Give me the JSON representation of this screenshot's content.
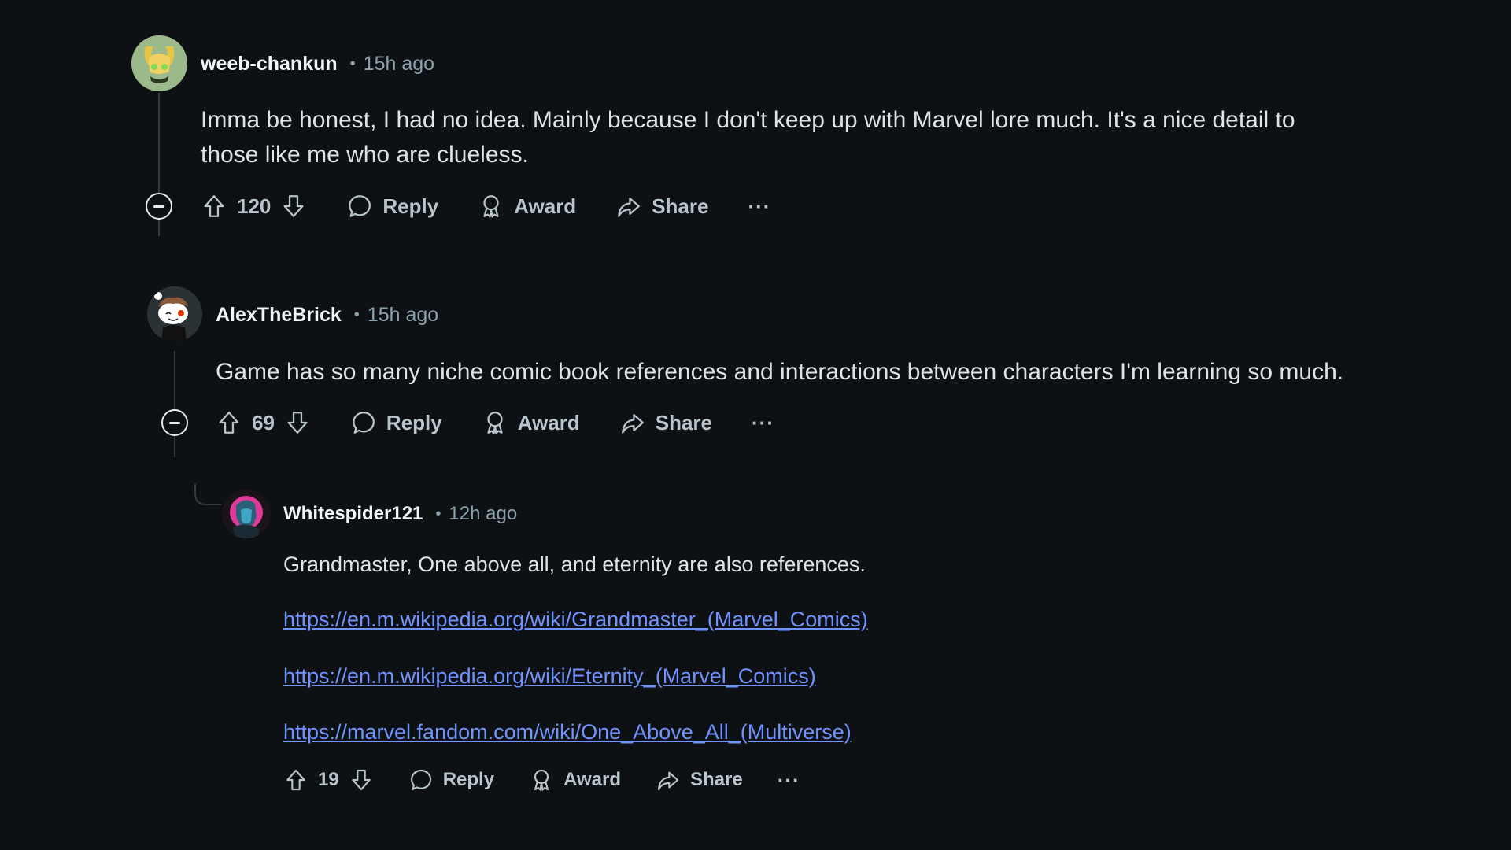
{
  "comments": [
    {
      "username": "weeb-chankun",
      "separator": "•",
      "time": "15h ago",
      "body_lines": [
        "Imma be honest, I had no idea. Mainly because I don't keep up with Marvel lore much. It's a nice detail to",
        "those like me who are clueless."
      ],
      "votes": "120",
      "avatar_icon": "loki-avatar",
      "actions": {
        "reply": "Reply",
        "award": "Award",
        "share": "Share",
        "more": "···"
      }
    },
    {
      "username": "AlexTheBrick",
      "separator": "•",
      "time": "15h ago",
      "body_lines": [
        "Game has so many niche comic book references and interactions between characters I'm learning so much."
      ],
      "votes": "69",
      "avatar_icon": "snoo-avatar",
      "actions": {
        "reply": "Reply",
        "award": "Award",
        "share": "Share",
        "more": "···"
      }
    },
    {
      "username": "Whitespider121",
      "separator": "•",
      "time": "12h ago",
      "body_lines": [
        "Grandmaster, One above all, and eternity are also references."
      ],
      "links": [
        "https://en.m.wikipedia.org/wiki/Grandmaster_(Marvel_Comics)",
        "https://en.m.wikipedia.org/wiki/Eternity_(Marvel_Comics)",
        "https://marvel.fandom.com/wiki/One_Above_All_(Multiverse)"
      ],
      "votes": "19",
      "avatar_icon": "hooded-figure-avatar",
      "actions": {
        "reply": "Reply",
        "award": "Award",
        "share": "Share",
        "more": "···"
      }
    }
  ],
  "colors": {
    "background": "#0e1113",
    "text": "#dfe3e6",
    "meta": "#8ba2ad",
    "link": "#7193ff"
  }
}
